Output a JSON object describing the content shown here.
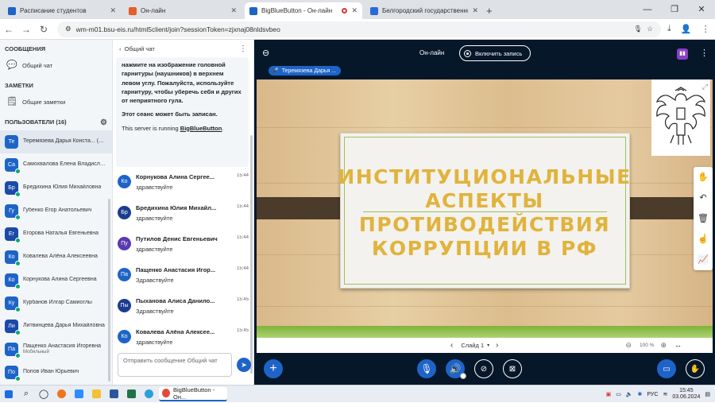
{
  "browser": {
    "tabs": [
      {
        "title": "Расписание студентов",
        "favicon_color": "#1e64c8",
        "active": false
      },
      {
        "title": "Он-лайн",
        "favicon_color": "#e85d2a",
        "active": false
      },
      {
        "title": "BigBlueButton - Он-лайн",
        "favicon_color": "#1e64c8",
        "active": true
      },
      {
        "title": "Белгородский государственный",
        "favicon_color": "#2a6ad8",
        "active": false
      }
    ],
    "url": "wm-m01.bsu-eis.ru/html5client/join?sessionToken=zjxnaj08nldsvbeo"
  },
  "left_panel": {
    "messages_heading": "СООБЩЕНИЯ",
    "public_chat": "Общий чат",
    "notes_heading": "ЗАМЕТКИ",
    "shared_notes": "Общие заметки",
    "users_heading": "ПОЛЬЗОВАТЕЛИ (16)",
    "users": [
      {
        "initials": "Те",
        "name": "Теремязева Дарья Конста... (Вы)",
        "sub": "",
        "color": "#1e64c8",
        "selected": true
      },
      {
        "initials": "Са",
        "name": "Самохвалова Елена Владисла...",
        "sub": "",
        "color": "#1e64c8",
        "selected": false
      },
      {
        "initials": "Бр",
        "name": "Бредихина Юлия Михайловна",
        "sub": "",
        "color": "#1b4aa8",
        "selected": false
      },
      {
        "initials": "Гу",
        "name": "Губенко Егор Анатольевич",
        "sub": "",
        "color": "#1e64c8",
        "selected": false
      },
      {
        "initials": "Ег",
        "name": "Егорова Наталья Евгеньевна",
        "sub": "",
        "color": "#1b4aa8",
        "selected": false
      },
      {
        "initials": "Ко",
        "name": "Ковалева Алёна Алексеевна",
        "sub": "",
        "color": "#1e64c8",
        "selected": false
      },
      {
        "initials": "Ко",
        "name": "Корнукова Алина Сергеевна",
        "sub": "",
        "color": "#1e64c8",
        "selected": false
      },
      {
        "initials": "Ку",
        "name": "Курбанов Илгар Самиоглы",
        "sub": "",
        "color": "#1e64c8",
        "selected": false
      },
      {
        "initials": "Ли",
        "name": "Литвинцева Дарья Михайловна",
        "sub": "",
        "color": "#1b4aa8",
        "selected": false
      },
      {
        "initials": "Па",
        "name": "Пащенко Анастасия Игоревна",
        "sub": "Мобильный",
        "color": "#1e64c8",
        "selected": false
      },
      {
        "initials": "По",
        "name": "Попов Иван Юрьевич",
        "sub": "",
        "color": "#1e64c8",
        "selected": false
      }
    ]
  },
  "chat": {
    "title": "Общий чат",
    "welcome_lead": "нажмите на изображение головной гарнитуры (наушников) в верхнем левом углу.",
    "welcome_bold": "Пожалуйста, используйте гарнитуру, чтобы уберечь себя и других от неприятного гула.",
    "welcome_record": "Этот сеанс может быть записан.",
    "server_prefix": "This server is running ",
    "server_link": "BigBlueButton",
    "server_suffix": ".",
    "messages": [
      {
        "initials": "Ко",
        "name": "Корнукова Алина Сергее...",
        "time": "15:44",
        "text": "здравствуйте",
        "color": "#1e64c8"
      },
      {
        "initials": "Бр",
        "name": "Бредихина Юлия Михайл...",
        "time": "15:44",
        "text": "здравствуйте",
        "color": "#1b3d8f"
      },
      {
        "initials": "Пу",
        "name": "Путилов Денис Евгеньевич",
        "time": "15:44",
        "text": "здравствуйте",
        "color": "#5a3ab0"
      },
      {
        "initials": "Па",
        "name": "Пащенко Анастасия Игор...",
        "time": "15:44",
        "text": "Здравствуйте",
        "color": "#1e64c8"
      },
      {
        "initials": "Пы",
        "name": "Пыханова Алиса Данило...",
        "time": "15:45",
        "text": "Здравствуйте",
        "color": "#1b3d8f"
      },
      {
        "initials": "Ко",
        "name": "Ковалева Алёна Алексее...",
        "time": "15:45",
        "text": "здравствуйте",
        "color": "#1e64c8"
      }
    ],
    "input_placeholder": "Отправить сообщение Общий чат"
  },
  "stage": {
    "status": "Он-лайн",
    "record_label": "Включить запись",
    "presenter": "Теремязева Дарья ...",
    "slide_title_line1": "ИНСТИТУЦИОНАЛЬНЫЕ",
    "slide_title_line2": "АСПЕКТЫ",
    "slide_title_line3": "ПРОТИВОДЕЙСТВИЯ",
    "slide_title_line4": "КОРРУПЦИИ В РФ",
    "slide_label": "Слайд 1",
    "zoom": "100 %"
  },
  "taskbar": {
    "active_app": "BigBlueButton - Он...",
    "lang": "РУС",
    "time": "15:45",
    "date": "03.06.2024"
  }
}
